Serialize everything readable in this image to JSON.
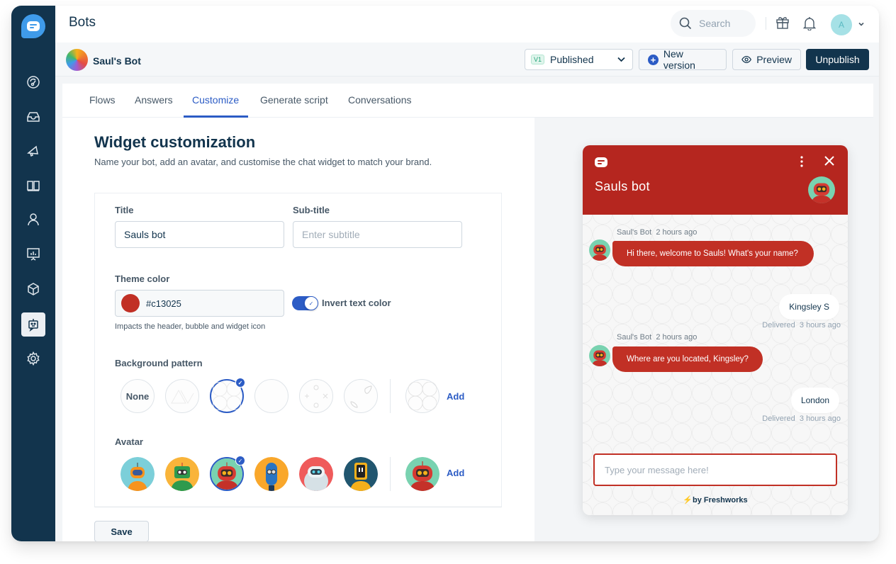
{
  "topbar": {
    "title": "Bots",
    "search_placeholder": "Search",
    "user_initial": "A"
  },
  "sidebar": {
    "items": [
      {
        "icon": "dashboard-icon",
        "active": false
      },
      {
        "icon": "inbox-icon",
        "active": false
      },
      {
        "icon": "megaphone-icon",
        "active": false
      },
      {
        "icon": "book-icon",
        "active": false
      },
      {
        "icon": "contacts-icon",
        "active": false
      },
      {
        "icon": "reports-icon",
        "active": false
      },
      {
        "icon": "box-icon",
        "active": false
      },
      {
        "icon": "bot-icon",
        "active": true
      },
      {
        "icon": "settings-icon",
        "active": false
      }
    ]
  },
  "subbar": {
    "bot_name": "Saul's Bot",
    "version_badge": "V1",
    "version_status": "Published",
    "new_version_label": "New version",
    "preview_label": "Preview",
    "unpublish_label": "Unpublish"
  },
  "tabs": [
    {
      "label": "Flows",
      "active": false
    },
    {
      "label": "Answers",
      "active": false
    },
    {
      "label": "Customize",
      "active": true
    },
    {
      "label": "Generate script",
      "active": false
    },
    {
      "label": "Conversations",
      "active": false
    }
  ],
  "customization": {
    "title": "Widget customization",
    "description": "Name your bot, add an avatar, and customise the chat widget to match your brand.",
    "title_label": "Title",
    "title_value": "Sauls bot",
    "subtitle_label": "Sub-title",
    "subtitle_placeholder": "Enter subtitle",
    "theme_color_label": "Theme color",
    "theme_color_value": "#c13025",
    "invert_text_label": "Invert text color",
    "invert_text_enabled": true,
    "theme_helper": "Impacts the header, bubble and widget icon",
    "background_pattern_label": "Background pattern",
    "patterns": [
      {
        "label": "None",
        "selected": false
      },
      {
        "label": "",
        "selected": false
      },
      {
        "label": "",
        "selected": true
      },
      {
        "label": "",
        "selected": false
      },
      {
        "label": "",
        "selected": false
      },
      {
        "label": "",
        "selected": false
      }
    ],
    "pattern_add_label": "Add",
    "avatar_label": "Avatar",
    "avatars": [
      {
        "name": "orange-robot",
        "bg": "#7ccfd9",
        "selected": false
      },
      {
        "name": "green-robot",
        "bg": "#f9b43a",
        "selected": false
      },
      {
        "name": "red-robot",
        "bg": "#79d2b0",
        "selected": true
      },
      {
        "name": "blue-robot",
        "bg": "#f9a72b",
        "selected": false
      },
      {
        "name": "white-robot",
        "bg": "#ef5b5b",
        "selected": false
      },
      {
        "name": "tablet-robot",
        "bg": "#21566f",
        "selected": false
      }
    ],
    "avatar_add_label": "Add",
    "save_label": "Save"
  },
  "widget": {
    "theme_color": "#c13025",
    "title": "Sauls bot",
    "messages": [
      {
        "from": "bot",
        "sender": "Saul's Bot",
        "time": "2 hours ago",
        "text": "Hi there, welcome to Sauls! What's your name?"
      },
      {
        "from": "user",
        "text": "Kingsley S",
        "status": "Delivered",
        "time": "3 hours ago"
      },
      {
        "from": "bot",
        "sender": "Saul's Bot",
        "time": "2 hours ago",
        "text": "Where are you located, Kingsley?"
      },
      {
        "from": "user",
        "text": "London",
        "status": "Delivered",
        "time": "3 hours ago"
      }
    ],
    "input_placeholder": "Type your message here!",
    "powered_by": "by Freshworks"
  }
}
